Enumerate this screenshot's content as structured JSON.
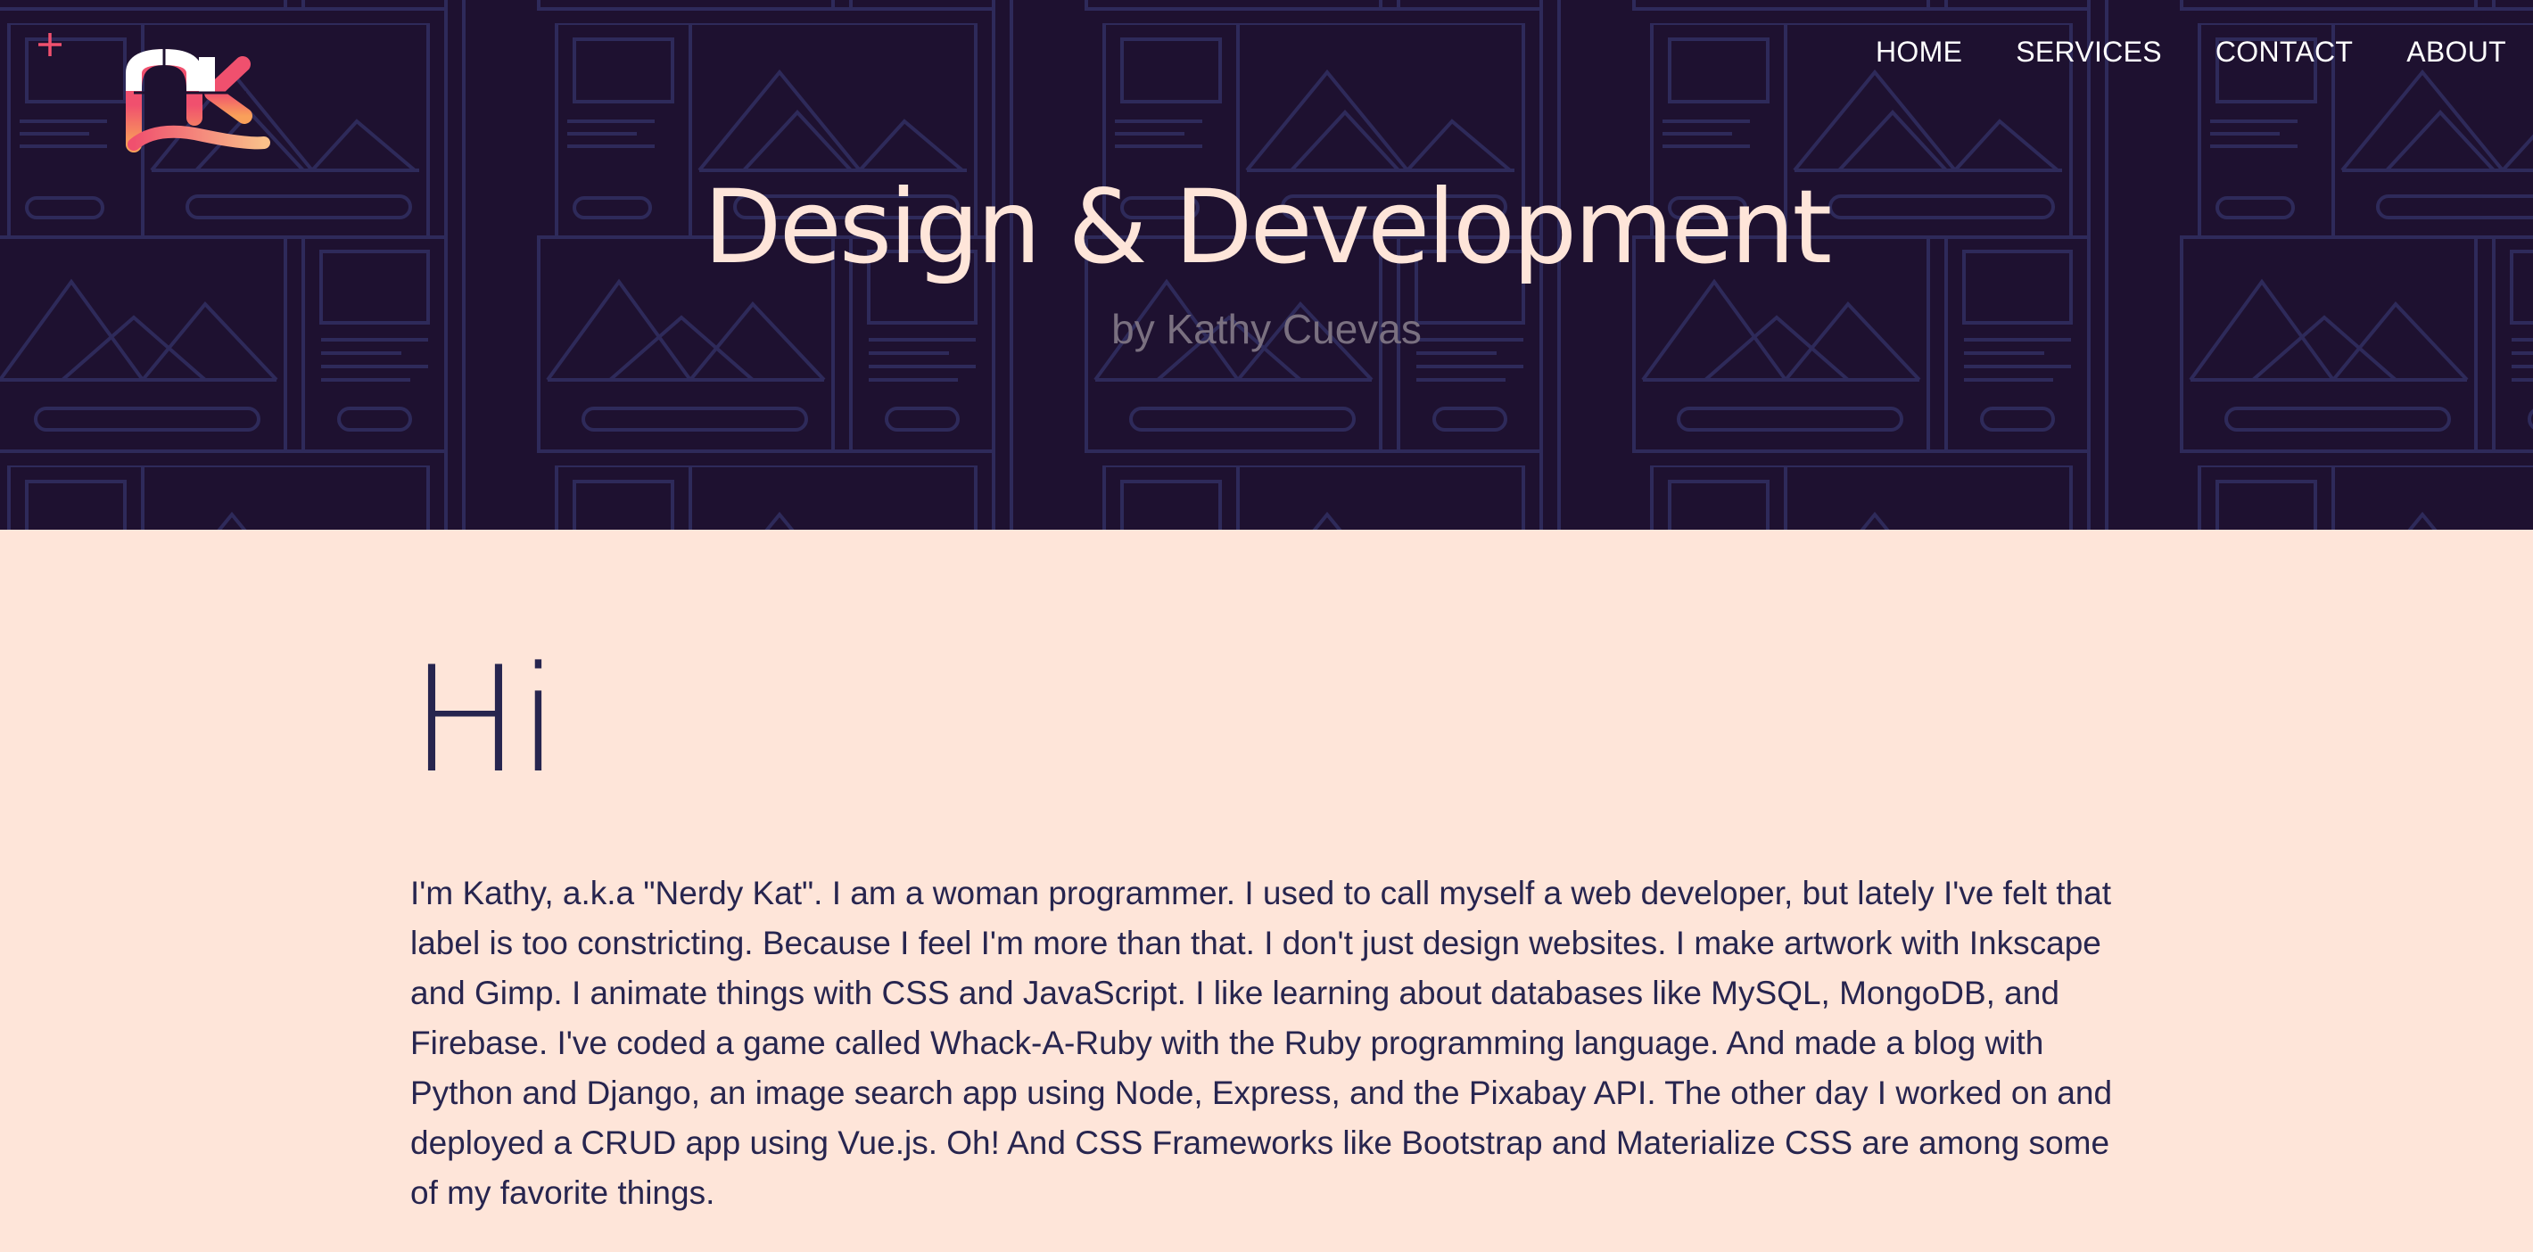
{
  "header": {
    "title": "Design & Development",
    "subtitle": "by Kathy Cuevas",
    "nav": [
      {
        "label": "HOME"
      },
      {
        "label": "SERVICES"
      },
      {
        "label": "CONTACT"
      },
      {
        "label": "ABOUT"
      }
    ],
    "menu_icon": "plus-icon",
    "logo_text": "nk"
  },
  "main": {
    "greeting": "Hi",
    "intro": "I'm Kathy, a.k.a \"Nerdy Kat\". I am a woman programmer. I used to call myself a web developer, but lately I've felt that label is too constricting. Because I feel I'm more than that. I don't just design websites. I make artwork with Inkscape and Gimp. I animate things with CSS and JavaScript. I like learning about databases like MySQL, MongoDB, and Firebase. I've coded a game called Whack-A-Ruby with the Ruby programming language. And made a blog with Python and Django, an image search app using Node, Express, and the Pixabay API. The other day I worked on and deployed a CRUD app using Vue.js. Oh! And CSS Frameworks like Bootstrap and Materialize CSS are among some of my favorite things."
  },
  "colors": {
    "hero_background": "#1e1130",
    "hero_pattern": "#2e2a5a",
    "page_background": "#fee5d9",
    "text_dark": "#27254f",
    "accent_pink": "#f0506e",
    "accent_orange": "#f9a05a"
  }
}
